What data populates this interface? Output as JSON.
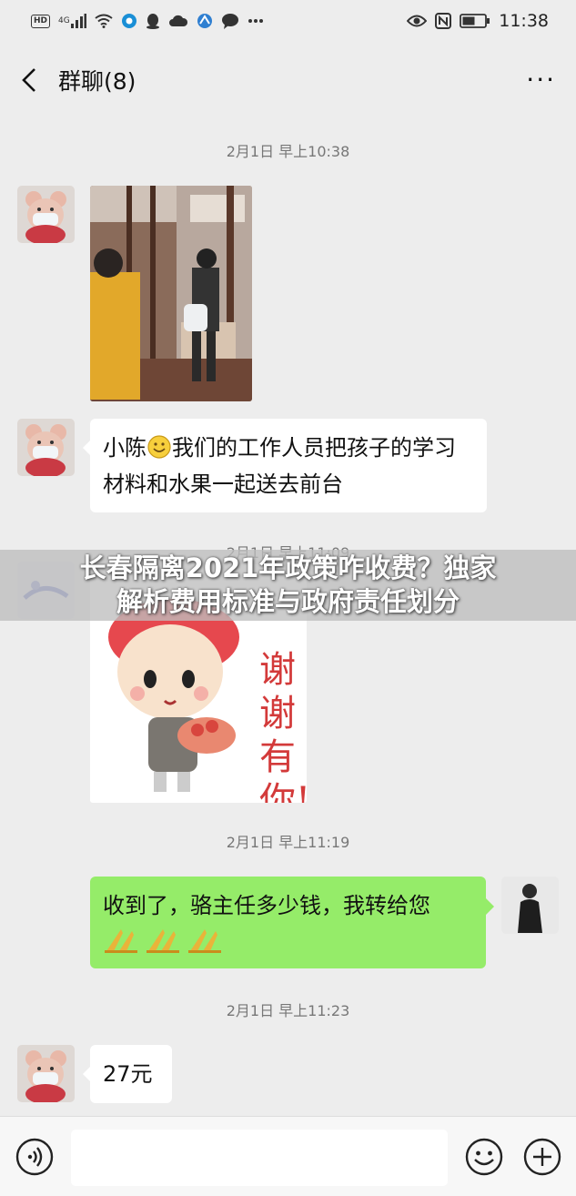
{
  "status_bar": {
    "hd": "HD",
    "network": "4G",
    "time": "11:38"
  },
  "nav": {
    "title": "群聊(8)",
    "more": "···"
  },
  "messages": {
    "ts1": "2月1日 早上10:38",
    "text1_before": "小陈",
    "text1_after": "我们的工作人员把孩子的学习材料和水果一起送去前台",
    "ts2": "2月1日 早上11:09",
    "sticker_text": "谢谢有你!",
    "ts3": "2月1日 早上11:19",
    "text2": "收到了，骆主任多少钱，我转给您",
    "ts4": "2月1日 早上11:23",
    "text3": "27元"
  },
  "banner": {
    "line1": "长春隔离2021年政策咋收费？独家",
    "line2": "解析费用标准与政府责任划分"
  },
  "icons": {
    "back": "chevron-left-icon",
    "voice": "voice-icon",
    "emoji": "smiley-icon",
    "add": "plus-icon"
  },
  "colors": {
    "background": "#ededed",
    "incoming_bubble": "#ffffff",
    "outgoing_bubble": "#95ec69"
  }
}
